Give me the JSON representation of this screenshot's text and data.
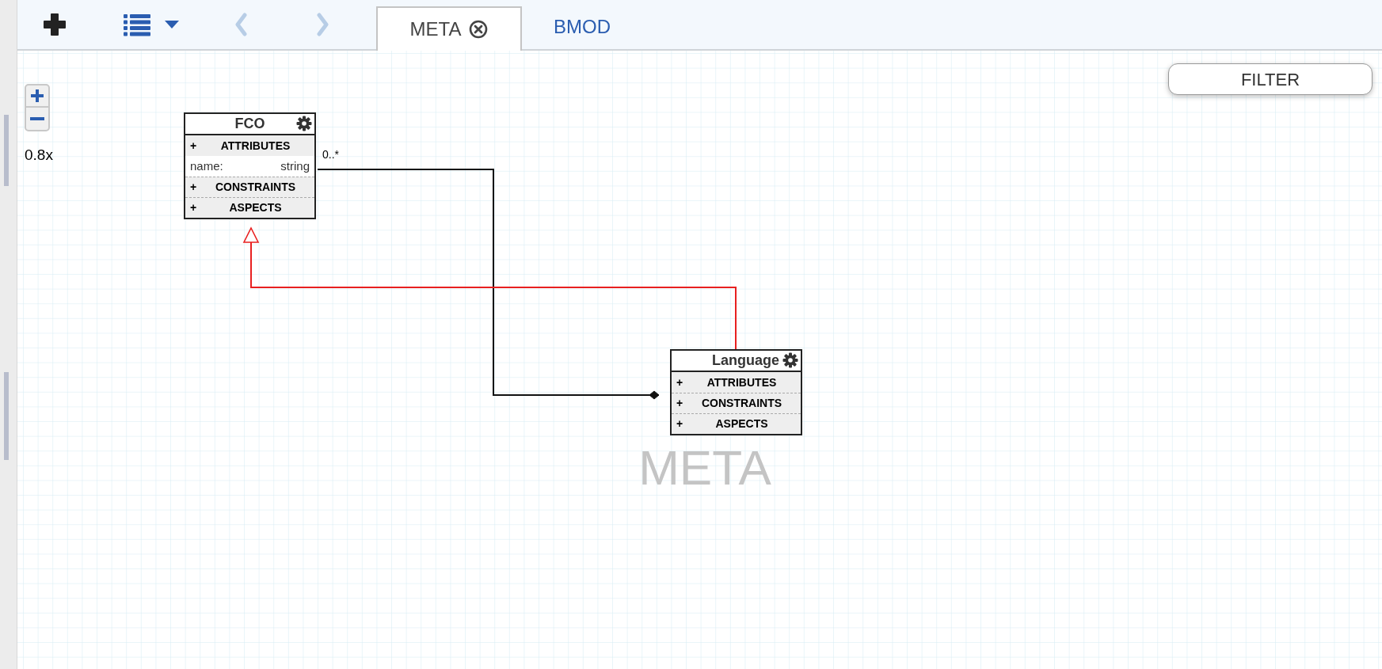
{
  "toolbar": {
    "nav_buttons": [
      {
        "kind": "back",
        "disabled": true
      },
      {
        "kind": "forward",
        "disabled": true
      }
    ]
  },
  "tabs": [
    {
      "label": "META",
      "selected": true,
      "closable": true
    },
    {
      "label": "BMOD",
      "selected": false,
      "closable": false
    }
  ],
  "zoom": {
    "level_label": "0.8x"
  },
  "filter_button": "FILTER",
  "canvas_label": "META",
  "nodes": [
    {
      "name": "FCO",
      "sections": [
        {
          "toggle": "+",
          "label": "ATTRIBUTES",
          "items": [
            {
              "name": "name:",
              "type": "string"
            }
          ]
        },
        {
          "toggle": "+",
          "label": "CONSTRAINTS"
        },
        {
          "toggle": "+",
          "label": "ASPECTS"
        }
      ]
    },
    {
      "name": "Language",
      "sections": [
        {
          "toggle": "+",
          "label": "ATTRIBUTES"
        },
        {
          "toggle": "+",
          "label": "CONSTRAINTS"
        },
        {
          "toggle": "+",
          "label": "ASPECTS"
        }
      ]
    }
  ],
  "connections": [
    {
      "kind": "containment",
      "multiplicity": "0..*"
    },
    {
      "kind": "inheritance"
    }
  ]
}
